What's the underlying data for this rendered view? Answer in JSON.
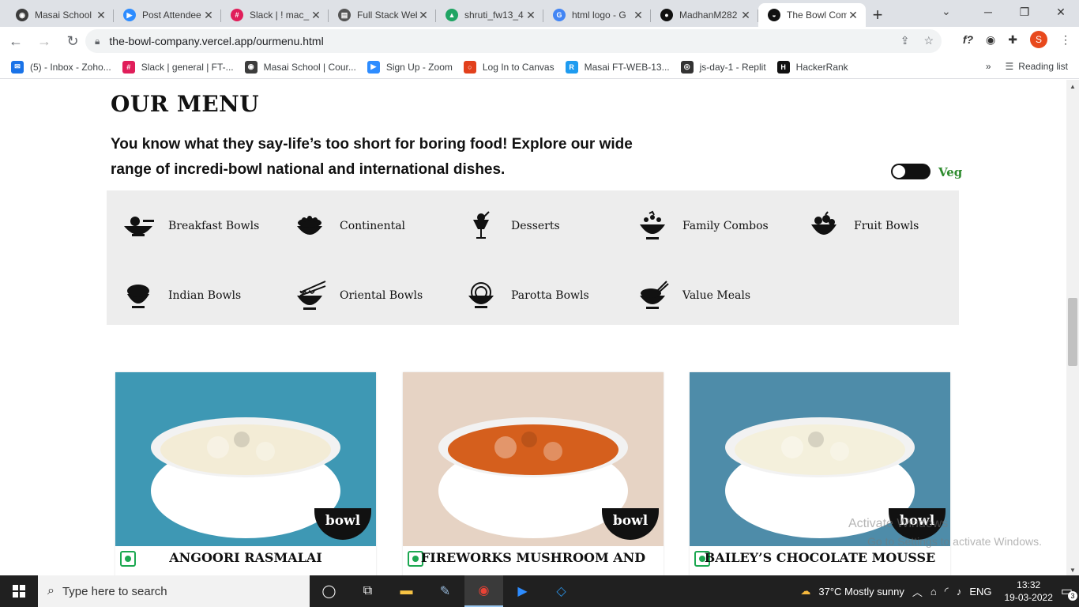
{
  "browser": {
    "tabs": [
      {
        "title": "Masai School",
        "fav_color": "#3c3c3c",
        "fav_glyph": "◉"
      },
      {
        "title": "Post Attendee",
        "fav_color": "#2d8cff",
        "fav_glyph": "▶"
      },
      {
        "title": "Slack | ! mac_",
        "fav_color": "#e01e5a",
        "fav_glyph": "#"
      },
      {
        "title": "Full Stack Web",
        "fav_color": "#555555",
        "fav_glyph": "▤"
      },
      {
        "title": "shruti_fw13_4",
        "fav_color": "#1fa463",
        "fav_glyph": "▲"
      },
      {
        "title": "html logo - G",
        "fav_color": "#4285f4",
        "fav_glyph": "G"
      },
      {
        "title": "MadhanM282",
        "fav_color": "#111111",
        "fav_glyph": "●"
      },
      {
        "title": "The Bowl Com",
        "fav_color": "#111111",
        "fav_glyph": "◒"
      }
    ],
    "new_tab": "+",
    "url": "the-bowl-company.vercel.app/ourmenu.html",
    "profile_initial": "S",
    "bookmarks": [
      {
        "label": "(5) - Inbox - Zoho...",
        "color": "#1a73e8",
        "glyph": "✉"
      },
      {
        "label": "Slack | general | FT-...",
        "color": "#e01e5a",
        "glyph": "#"
      },
      {
        "label": "Masai School | Cour...",
        "color": "#3c3c3c",
        "glyph": "◉"
      },
      {
        "label": "Sign Up - Zoom",
        "color": "#2d8cff",
        "glyph": "▶"
      },
      {
        "label": "Log In to Canvas",
        "color": "#e2401c",
        "glyph": "○"
      },
      {
        "label": "Masai FT-WEB-13...",
        "color": "#1e9bf0",
        "glyph": "R"
      },
      {
        "label": "js-day-1 - Replit",
        "color": "#333333",
        "glyph": "◎"
      },
      {
        "label": "HackerRank",
        "color": "#111111",
        "glyph": "H"
      }
    ],
    "bookmarks_overflow": "»",
    "reading_list": "Reading list"
  },
  "page": {
    "title": "OUR MENU",
    "intro": "You know what they say-life’s too short for boring food! Explore our wide range of incredi-bowl national and international dishes.",
    "veg_label": "Veg",
    "categories": [
      {
        "label": "Breakfast Bowls",
        "icon": "breakfast-bowl-icon"
      },
      {
        "label": "Continental",
        "icon": "continental-icon"
      },
      {
        "label": "Desserts",
        "icon": "dessert-icon"
      },
      {
        "label": "Family Combos",
        "icon": "family-combo-icon"
      },
      {
        "label": "Fruit Bowls",
        "icon": "fruit-bowl-icon"
      },
      {
        "label": "Indian Bowls",
        "icon": "indian-bowl-icon"
      },
      {
        "label": "Oriental Bowls",
        "icon": "oriental-bowl-icon"
      },
      {
        "label": "Parotta Bowls",
        "icon": "parotta-bowl-icon"
      },
      {
        "label": "Value Meals",
        "icon": "value-meal-icon"
      }
    ],
    "dishes": [
      {
        "name": "ANGOORI RASMALAI",
        "bg": "#3e98b4",
        "food": "#f3ecd6"
      },
      {
        "name": "FIREWORKS MUSHROOM AND",
        "bg": "#e6d3c4",
        "food": "#d55f1d"
      },
      {
        "name": "BAILEY’S CHOCOLATE MOUSSE",
        "bg": "#4e8ca9",
        "food": "#f4f0dc"
      }
    ],
    "brand_logo": "bowl"
  },
  "watermark": {
    "line1": "Activate Windows",
    "line2": "Go to Settings to activate Windows."
  },
  "taskbar": {
    "search_placeholder": "Type here to search",
    "weather": "37°C  Mostly sunny",
    "lang": "ENG",
    "time": "13:32",
    "date": "19-03-2022",
    "notifications": "3"
  }
}
